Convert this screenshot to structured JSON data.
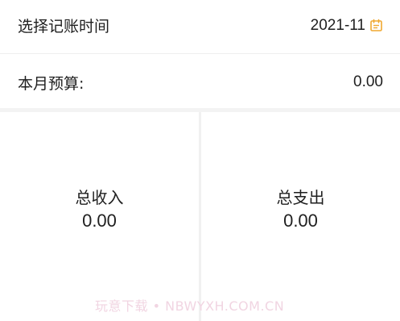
{
  "date_row": {
    "label": "选择记账时间",
    "value": "2021-11",
    "icon": "calendar-icon",
    "icon_color": "#f0a830"
  },
  "budget_row": {
    "label": "本月预算:",
    "value": "0.00"
  },
  "summary": {
    "income": {
      "label": "总收入",
      "value": "0.00"
    },
    "expense": {
      "label": "总支出",
      "value": "0.00"
    }
  },
  "watermark": "玩意下载 • NBWYXH.COM.CN"
}
